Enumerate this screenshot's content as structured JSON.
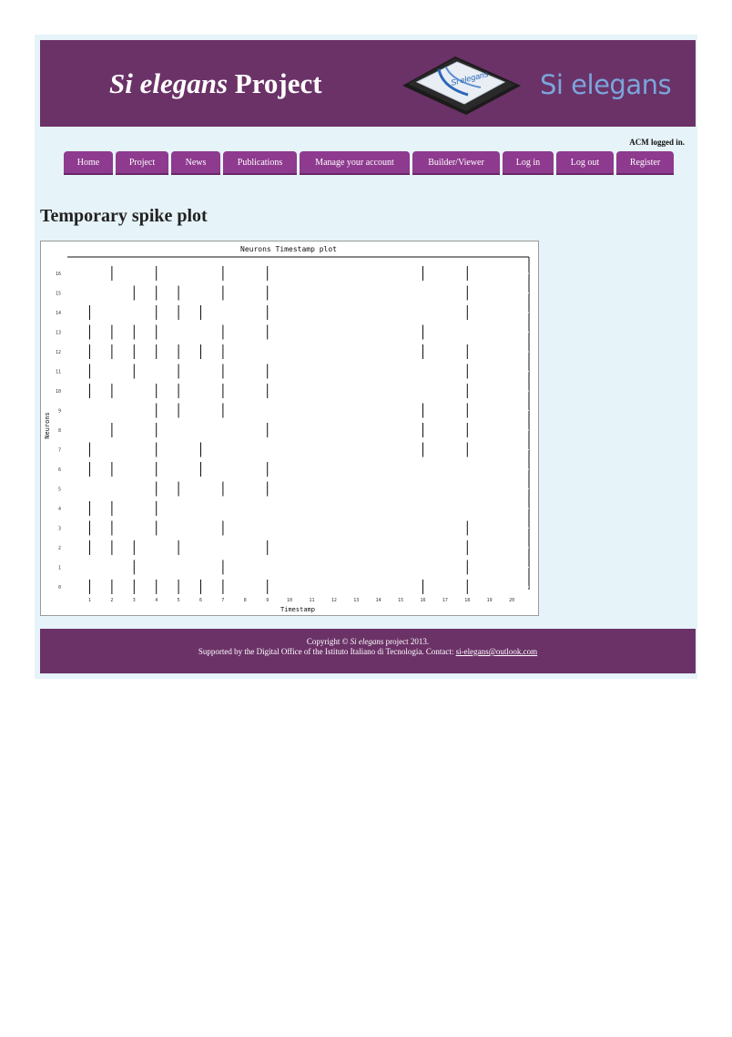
{
  "banner": {
    "title_italic": "Si elegans",
    "title_rest": " Project",
    "chip_text": "Si elegans",
    "logo_text": "Si elegans"
  },
  "login_status": "ACM logged in.",
  "nav": [
    {
      "label": "Home"
    },
    {
      "label": "Project"
    },
    {
      "label": "News"
    },
    {
      "label": "Publications"
    },
    {
      "label": "Manage your account"
    },
    {
      "label": "Builder/Viewer"
    },
    {
      "label": "Log in"
    },
    {
      "label": "Log out"
    },
    {
      "label": "Register"
    }
  ],
  "heading": "Temporary spike plot",
  "chart_data": {
    "type": "scatter",
    "title": "Neurons Timestamp plot",
    "xlabel": "Timestamp",
    "ylabel": "Neurons",
    "x_ticks": [
      "1",
      "2",
      "3",
      "4",
      "5",
      "6",
      "7",
      "8",
      "9",
      "10",
      "11",
      "12",
      "13",
      "14",
      "15",
      "16",
      "17",
      "18",
      "19",
      "20"
    ],
    "y_ticks": [
      "16",
      "15",
      "14",
      "13",
      "12",
      "11",
      "10",
      "9",
      "8",
      "7",
      "6",
      "5",
      "4",
      "3",
      "2",
      "1",
      "0"
    ],
    "grid": false,
    "spikes": [
      {
        "neuron": 16,
        "t": [
          2,
          4,
          7,
          9,
          16,
          18
        ]
      },
      {
        "neuron": 15,
        "t": [
          3,
          4,
          5,
          7,
          9,
          18
        ]
      },
      {
        "neuron": 14,
        "t": [
          1,
          4,
          5,
          6,
          9,
          18
        ]
      },
      {
        "neuron": 13,
        "t": [
          1,
          2,
          3,
          4,
          7,
          9,
          16
        ]
      },
      {
        "neuron": 12,
        "t": [
          1,
          2,
          3,
          4,
          5,
          6,
          7,
          16,
          18
        ]
      },
      {
        "neuron": 11,
        "t": [
          1,
          3,
          5,
          7,
          9,
          18
        ]
      },
      {
        "neuron": 10,
        "t": [
          1,
          2,
          4,
          5,
          7,
          9,
          18
        ]
      },
      {
        "neuron": 9,
        "t": [
          4,
          5,
          7,
          16,
          18
        ]
      },
      {
        "neuron": 8,
        "t": [
          2,
          4,
          9,
          16,
          18
        ]
      },
      {
        "neuron": 7,
        "t": [
          1,
          4,
          6,
          16,
          18
        ]
      },
      {
        "neuron": 6,
        "t": [
          1,
          2,
          4,
          6,
          9
        ]
      },
      {
        "neuron": 5,
        "t": [
          4,
          5,
          7,
          9
        ]
      },
      {
        "neuron": 4,
        "t": [
          1,
          2,
          4
        ]
      },
      {
        "neuron": 3,
        "t": [
          1,
          2,
          4,
          7,
          18
        ]
      },
      {
        "neuron": 2,
        "t": [
          1,
          2,
          3,
          5,
          9,
          18
        ]
      },
      {
        "neuron": 1,
        "t": [
          3,
          7,
          18
        ]
      },
      {
        "neuron": 0,
        "t": [
          1,
          2,
          3,
          4,
          5,
          6,
          7,
          9,
          16,
          18
        ]
      }
    ]
  },
  "footer": {
    "copyright_prefix": "Copyright © ",
    "copyright_italic": "Si elegans",
    "copyright_suffix": " project 2013.",
    "support_text": "Supported by the Digital Office of the Istituto Italiano di Tecnologia. Contact: ",
    "contact_email": "si-elegans@outlook.com"
  }
}
